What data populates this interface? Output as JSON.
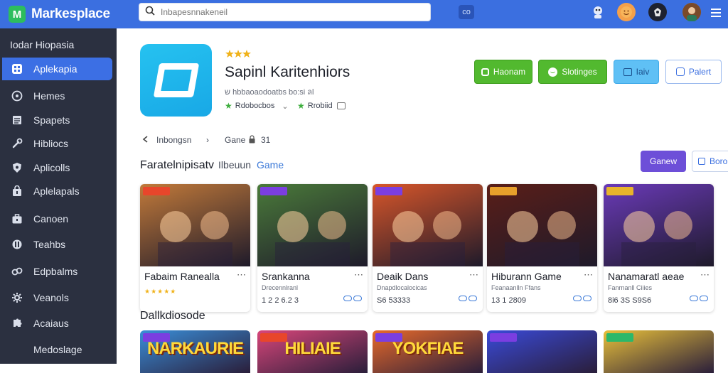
{
  "brand": {
    "name": "Markesplace"
  },
  "search": {
    "placeholder": "Inbapesnnakeneil"
  },
  "topbar": {
    "button_label": "co"
  },
  "sidebar": {
    "title": "Iodar Hiopasia",
    "items": [
      {
        "label": "Aplekapia",
        "icon": "apps-icon"
      },
      {
        "label": "Hemes",
        "icon": "home-icon"
      },
      {
        "label": "Spapets",
        "icon": "list-icon"
      },
      {
        "label": "Hibliocs",
        "icon": "wrench-icon"
      },
      {
        "label": "Aplicolls",
        "icon": "shield-icon"
      },
      {
        "label": "Aplelapals",
        "icon": "bag-icon"
      },
      {
        "label": "Canoen",
        "icon": "briefcase-icon"
      },
      {
        "label": "Teahbs",
        "icon": "tag-icon"
      },
      {
        "label": "Edpbalms",
        "icon": "link-icon"
      },
      {
        "label": "Veanols",
        "icon": "settings-icon"
      },
      {
        "label": "Acaiaus",
        "icon": "puzzle-icon"
      },
      {
        "label": "Medoslage",
        "icon": ""
      }
    ]
  },
  "app": {
    "title": "Sapinl Karitenhiors",
    "subtitle": "ש hbbaoaodoatbs bo:si ลl",
    "tag1": "Rdobocbos",
    "tag2": "Rrobiid",
    "tag2_icon": "badge-icon"
  },
  "actions": [
    {
      "label": "Haonam",
      "bg": "#52b92f",
      "color": "#ffffff",
      "border": "#3f9e1e"
    },
    {
      "label": "Slotinges",
      "bg": "#52b92f",
      "color": "#ffffff",
      "border": "#3f9e1e"
    },
    {
      "label": "Iaiv",
      "bg": "#5fc0f5",
      "color": "#1a4f8c",
      "border": "#3ea9e8"
    },
    {
      "label": "Palert",
      "bg": "#ffffff",
      "color": "#3b6fe0",
      "border": "#9ab9ee"
    }
  ],
  "breadcrumb": {
    "item1": "Inbongsn",
    "item2": "Gane",
    "item3": "31"
  },
  "section1": {
    "title": "Faratelnipisatv",
    "sub": "Ilbeuun",
    "link": "Game"
  },
  "buttons": {
    "primary": "Ganew",
    "secondary": "Boro"
  },
  "cards": [
    {
      "name": "Fabaim Ranealla",
      "dev": "",
      "price": "",
      "stars": "★★★★★",
      "badge_color": "#e8462b",
      "bg": "#c27a3a"
    },
    {
      "name": "Srankanna",
      "dev": "Drecennlranl",
      "price": "1 2 2 6.2 3",
      "stars": "",
      "badge_color": "#7b3ee0",
      "bg": "#4a7a3a"
    },
    {
      "name": "Deaik Dans",
      "dev": "Dnapdlocalocicas",
      "price": "S6 53333",
      "stars": "",
      "badge_color": "#7b3ee0",
      "bg": "#d8562a"
    },
    {
      "name": "Hiburann Game",
      "dev": "Feanaanlln Ffans",
      "price": "13 1 2809",
      "stars": "",
      "badge_color": "#e8a02b",
      "bg": "#5a1e18"
    },
    {
      "name": "Nanamaratl aeae",
      "dev": "Fanrnanll Ciiies",
      "price": "8i6 3S S9S6",
      "stars": "",
      "badge_color": "#e8b42b",
      "bg": "#6a3ab8"
    }
  ],
  "section2": {
    "title": "Dallkdiosode"
  },
  "cards2": [
    {
      "art": "NARKAURIE",
      "badge_color": "#7b3ee0",
      "bg": "#3a8ed8"
    },
    {
      "art": "HILIAIE",
      "badge_color": "#e8462b",
      "bg": "#d8467a"
    },
    {
      "art": "YOKFIAE",
      "badge_color": "#7b3ee0",
      "bg": "#e86a2a"
    },
    {
      "art": "",
      "badge_color": "#7b3ee0",
      "bg": "#3a4ad8"
    },
    {
      "art": "",
      "badge_color": "#2bb86a",
      "bg": "#e8c03a"
    }
  ]
}
